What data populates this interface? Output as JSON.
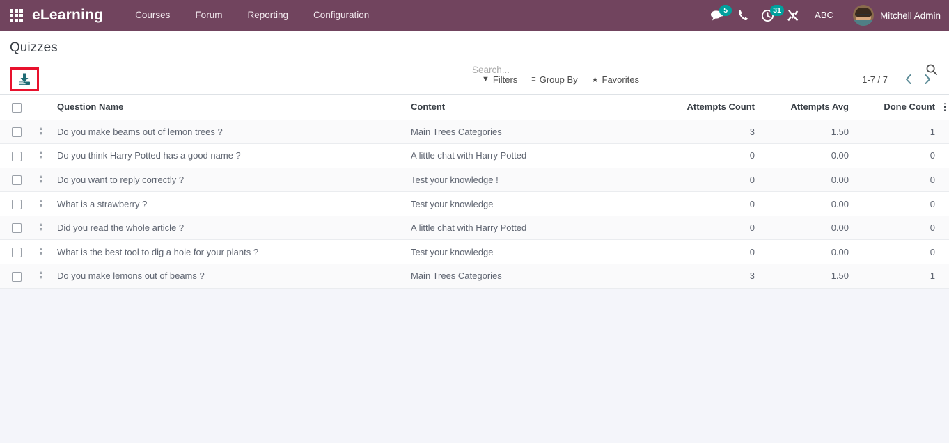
{
  "navbar": {
    "apps_icon": "apps-grid-icon",
    "brand": "eLearning",
    "menu": [
      {
        "label": "Courses"
      },
      {
        "label": "Forum"
      },
      {
        "label": "Reporting"
      },
      {
        "label": "Configuration"
      }
    ],
    "systray": {
      "messages": {
        "icon": "messages-icon",
        "badge": "5"
      },
      "phone": {
        "icon": "phone-icon"
      },
      "activities": {
        "icon": "clock-icon",
        "badge": "31"
      },
      "debug": {
        "icon": "tools-icon"
      },
      "language": {
        "label": "ABC"
      }
    },
    "user": {
      "name": "Mitchell Admin",
      "avatar_icon": "user-avatar"
    },
    "accent_color": "#71445E",
    "badge_color": "#00A09D"
  },
  "control_panel": {
    "breadcrumb": "Quizzes",
    "import_button": {
      "icon": "download-import-icon",
      "highlight_color": "#E8112D",
      "icon_color": "#1F6B75"
    },
    "search": {
      "placeholder": "Search...",
      "value": "",
      "icon": "search-icon"
    },
    "filters": [
      {
        "label": "Filters",
        "icon": "filter-funnel-icon"
      },
      {
        "label": "Group By",
        "icon": "group-lines-icon"
      },
      {
        "label": "Favorites",
        "icon": "star-icon"
      }
    ],
    "pager": {
      "range": "1-7 / 7",
      "prev_icon": "chevron-left-icon",
      "next_icon": "chevron-right-icon"
    }
  },
  "table": {
    "select_all_checked": false,
    "optional_columns_icon": "vertical-dots-icon",
    "columns": [
      {
        "key": "name",
        "label": "Question Name",
        "align": "left"
      },
      {
        "key": "content",
        "label": "Content",
        "align": "left"
      },
      {
        "key": "attempts_count",
        "label": "Attempts Count",
        "align": "right"
      },
      {
        "key": "attempts_avg",
        "label": "Attempts Avg",
        "align": "right"
      },
      {
        "key": "done_count",
        "label": "Done Count",
        "align": "right"
      }
    ],
    "rows": [
      {
        "name": "Do you make beams out of lemon trees ?",
        "content": "Main Trees Categories",
        "attempts_count": "3",
        "attempts_avg": "1.50",
        "done_count": "1",
        "checked": false
      },
      {
        "name": "Do you think Harry Potted has a good name ?",
        "content": "A little chat with Harry Potted",
        "attempts_count": "0",
        "attempts_avg": "0.00",
        "done_count": "0",
        "checked": false
      },
      {
        "name": "Do you want to reply correctly ?",
        "content": "Test your knowledge !",
        "attempts_count": "0",
        "attempts_avg": "0.00",
        "done_count": "0",
        "checked": false
      },
      {
        "name": "What is a strawberry ?",
        "content": "Test your knowledge",
        "attempts_count": "0",
        "attempts_avg": "0.00",
        "done_count": "0",
        "checked": false
      },
      {
        "name": "Did you read the whole article ?",
        "content": "A little chat with Harry Potted",
        "attempts_count": "0",
        "attempts_avg": "0.00",
        "done_count": "0",
        "checked": false
      },
      {
        "name": "What is the best tool to dig a hole for your plants ?",
        "content": "Test your knowledge",
        "attempts_count": "0",
        "attempts_avg": "0.00",
        "done_count": "0",
        "checked": false
      },
      {
        "name": "Do you make lemons out of beams ?",
        "content": "Main Trees Categories",
        "attempts_count": "3",
        "attempts_avg": "1.50",
        "done_count": "1",
        "checked": false
      }
    ]
  }
}
